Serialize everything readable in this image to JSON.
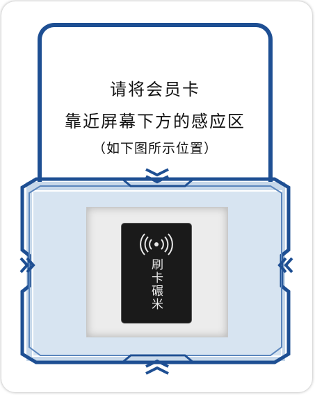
{
  "prompt": {
    "line1": "请将会员卡",
    "line2": "靠近屏幕下方的感应区",
    "line3": "（如下图所示位置）"
  },
  "reader": {
    "label": "刷卡碾米",
    "icon": "rfid-signal-icon"
  },
  "colors": {
    "frame": "#1e4f93",
    "area": "#c7d8ea"
  }
}
